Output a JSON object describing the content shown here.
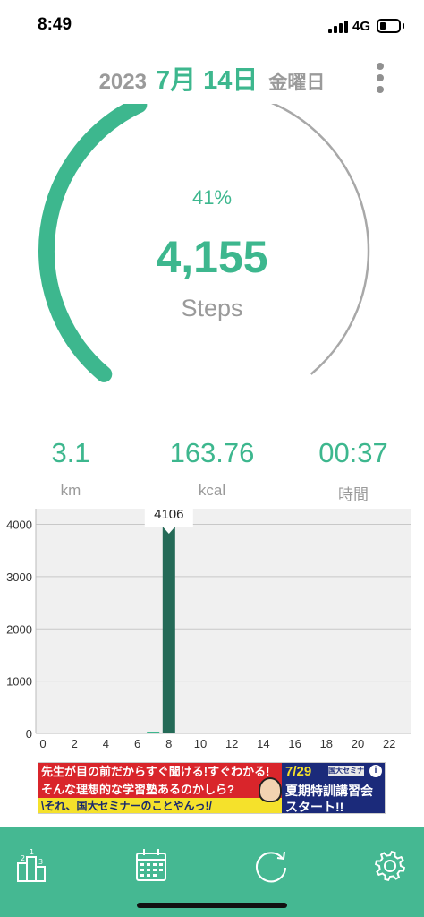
{
  "status": {
    "time": "8:49",
    "network": "4G"
  },
  "date": {
    "year": "2023",
    "month_day": "7月 14日",
    "weekday": "金曜日"
  },
  "progress": {
    "percent_label": "41%",
    "fraction": 0.41,
    "steps": "4,155",
    "unit": "Steps"
  },
  "stats": [
    {
      "value": "3.1",
      "unit": "km"
    },
    {
      "value": "163.76",
      "unit": "kcal"
    },
    {
      "value": "00:37",
      "unit": "時間"
    }
  ],
  "chart_data": {
    "type": "bar",
    "x": [
      0,
      1,
      2,
      3,
      4,
      5,
      6,
      7,
      8,
      9,
      10,
      11,
      12,
      13,
      14,
      15,
      16,
      17,
      18,
      19,
      20,
      21,
      22,
      23
    ],
    "values": [
      0,
      0,
      0,
      0,
      0,
      0,
      0,
      49,
      4106,
      0,
      0,
      0,
      0,
      0,
      0,
      0,
      0,
      0,
      0,
      0,
      0,
      0,
      0,
      0
    ],
    "x_tick_labels": [
      "0",
      "2",
      "4",
      "6",
      "8",
      "10",
      "12",
      "14",
      "16",
      "18",
      "20",
      "22"
    ],
    "y_tick_labels": [
      "0",
      "1000",
      "2000",
      "3000",
      "4000"
    ],
    "ylim": [
      0,
      4300
    ],
    "tooltip": {
      "x": 8,
      "label": "4106"
    },
    "grid": true,
    "colors": {
      "bar": "#246a57",
      "bar_small": "#3db78e",
      "plot_bg": "#f0f0f0"
    }
  },
  "ad": {
    "line1": "先生が目の前だからすぐ聞ける!すぐわかる!",
    "line2": "そんな理想的な学習塾あるのかしら?",
    "line3": "\\それ、国大セミナーのことやんっ!/",
    "date": "7/29",
    "badge": "国大セミナー",
    "title": "夏期特訓講習会",
    "subtitle": "スタート!!",
    "info": "i"
  },
  "tabbar": {
    "items": [
      {
        "icon": "ranking-podium-icon"
      },
      {
        "icon": "calendar-icon"
      },
      {
        "icon": "refresh-icon"
      },
      {
        "icon": "settings-gear-icon"
      }
    ]
  },
  "colors": {
    "accent": "#3db78e",
    "tabbar": "#45b892",
    "muted": "#9a9a9a"
  }
}
